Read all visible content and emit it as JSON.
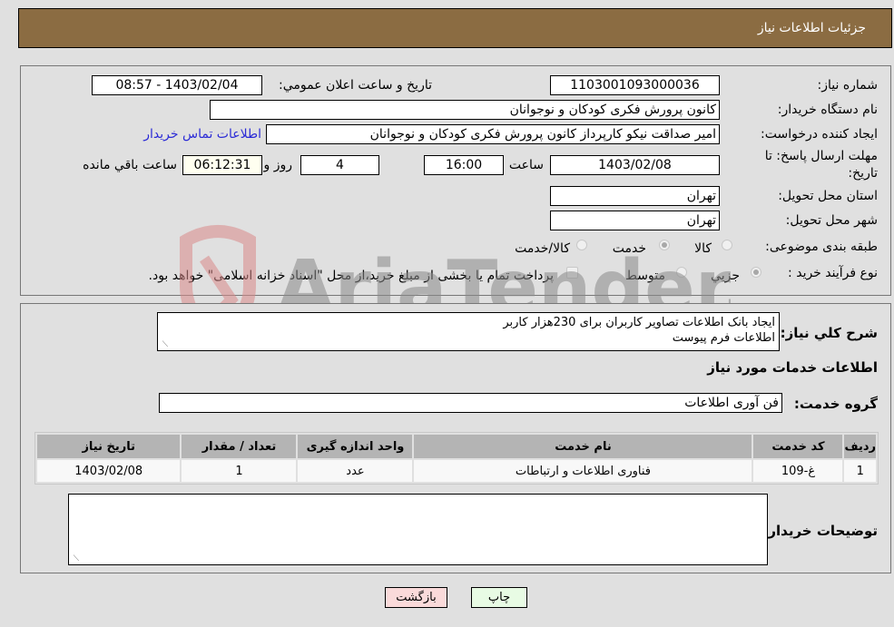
{
  "header": {
    "title": "جزئیات اطلاعات نیاز"
  },
  "form": {
    "need_number": {
      "label": "شماره نیاز:",
      "value": "1103001093000036"
    },
    "announce_datetime": {
      "label": "تاریخ و ساعت اعلان عمومي:",
      "value": "1403/02/04 - 08:57"
    },
    "buyer_org": {
      "label": "نام دستگاه خریدار:",
      "value": "کانون پرورش فکری کودکان و نوجوانان"
    },
    "requester": {
      "label": "ایجاد کننده درخواست:",
      "value": "امیر صداقت نیکو کارپرداز کانون پرورش فکری کودکان و نوجوانان"
    },
    "buyer_contact_link": "اطلاعات تماس خریدار",
    "deadline": {
      "label_line1": "مهلت ارسال پاسخ: تا",
      "label_line2": "تاریخ:",
      "date": "1403/02/08",
      "time_label": "ساعت",
      "time": "16:00",
      "days": "4",
      "days_label": "روز و",
      "remaining": "06:12:31",
      "remaining_label": "ساعت باقي مانده"
    },
    "province": {
      "label": "استان محل تحویل:",
      "value": "تهران"
    },
    "city": {
      "label": "شهر محل تحویل:",
      "value": "تهران"
    },
    "category": {
      "label": "طبقه بندی موضوعی:",
      "options": [
        {
          "label": "کالا",
          "selected": false
        },
        {
          "label": "خدمت",
          "selected": true
        },
        {
          "label": "کالا/خدمت",
          "selected": false
        }
      ]
    },
    "purchase_process": {
      "label": "نوع فرآیند خرید :",
      "options": [
        {
          "label": "جزيي",
          "selected": true
        },
        {
          "label": "متوسط",
          "selected": false
        }
      ],
      "treasury_note": "پرداخت تمام یا بخشی از مبلغ خرید،از محل \"اسناد خزانه اسلامی\" خواهد بود.",
      "treasury_checked": false
    }
  },
  "description": {
    "label": "شرح کلي نیاز:",
    "line1": "ایجاد بانک اطلاعات تصاویر کاربران برای 230هزار کاربر",
    "line2": "اطلاعات فرم پیوست"
  },
  "services": {
    "section_title": "اطلاعات خدمات مورد نیاز",
    "group_label": "گروه خدمت:",
    "group_value": "فن آوری اطلاعات",
    "table": {
      "headers": [
        "ردیف",
        "کد خدمت",
        "نام خدمت",
        "واحد اندازه گیری",
        "تعداد / مقدار",
        "تاریخ نیاز"
      ],
      "rows": [
        [
          "1",
          "غ-109",
          "فناوری اطلاعات و ارتباطات",
          "عدد",
          "1",
          "1403/02/08"
        ]
      ]
    }
  },
  "buyer_notes": {
    "label": "توضیحات خریدار:",
    "value": ""
  },
  "buttons": {
    "print": "چاپ",
    "back": "بازگشت"
  },
  "watermark": {
    "text": "AriaTender.neT"
  }
}
